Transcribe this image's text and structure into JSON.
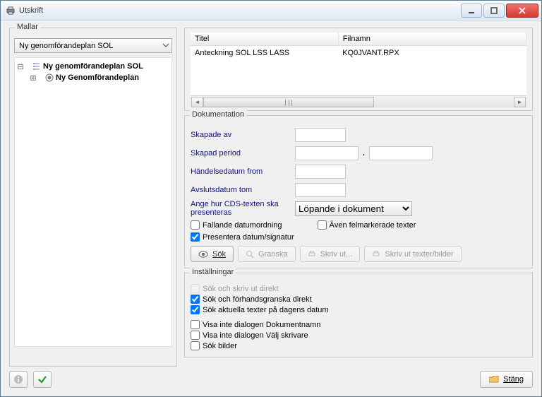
{
  "window": {
    "title": "Utskrift"
  },
  "mallar": {
    "label": "Mallar",
    "selected": "Ny genomförandeplan SOL",
    "tree": {
      "root": "Ny genomförandeplan SOL",
      "child": "Ny Genomförandeplan"
    }
  },
  "table": {
    "headers": {
      "title": "Titel",
      "filename": "Filnamn"
    },
    "row": {
      "title": "Anteckning SOL LSS LASS",
      "filename": "KQ0JVANT.RPX"
    }
  },
  "dokumentation": {
    "legend": "Dokumentation",
    "skapade_av": "Skapade av",
    "skapad_period": "Skapad period",
    "handelsedatum": "Händelsedatum from",
    "avslutsdatum": "Avslutsdatum tom",
    "cds_label": "Ange hur CDS-texten ska presenteras",
    "cds_value": "Löpande i dokument",
    "fallande": "Fallande datumordning",
    "aven": "Även felmarkerade texter",
    "presentera": "Presentera datum/signatur",
    "buttons": {
      "sok": "Sök",
      "granska": "Granska",
      "skriv_ut": "Skriv ut...",
      "skriv_ut_tb": "Skriv ut texter/bilder"
    }
  },
  "inst": {
    "legend": "Inställningar",
    "sok_direkt": "Sök och skriv ut direkt",
    "sok_forhands": "Sök och förhandsgranska direkt",
    "sok_aktuella": "Sök aktuella texter på dagens datum",
    "visa_dok": "Visa inte dialogen Dokumentnamn",
    "visa_valj": "Visa inte dialogen Välj skrivare",
    "sok_bilder": "Sök bilder"
  },
  "footer": {
    "stang": "Stäng"
  }
}
